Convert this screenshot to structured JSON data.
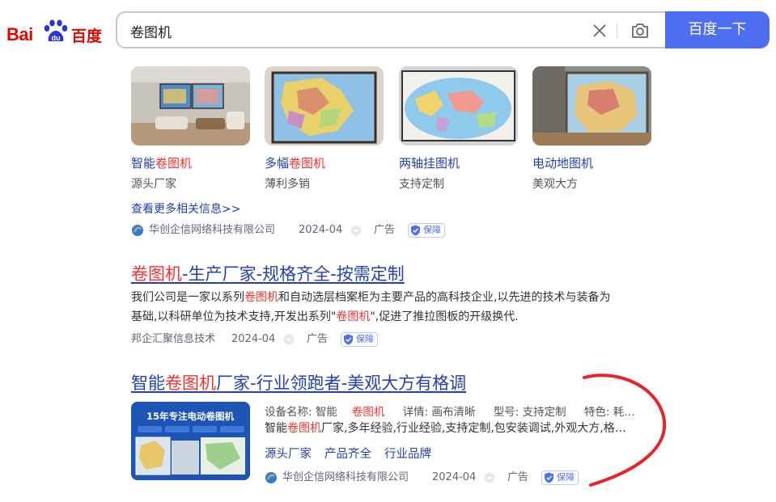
{
  "logo": {
    "bai": "Bai",
    "du": "du",
    "cn": "百度"
  },
  "search": {
    "value": "卷图机",
    "button": "百度一下"
  },
  "image_cards": [
    {
      "title_hl": "智能",
      "title_red": "卷图机",
      "title_tail": "",
      "sub": "源头厂家"
    },
    {
      "title_hl": "多幅",
      "title_red": "卷图机",
      "title_tail": "",
      "sub": "薄利多销"
    },
    {
      "title_hl": "两轴挂图机",
      "title_red": "",
      "title_tail": "",
      "sub": "支持定制"
    },
    {
      "title_hl": "电动地图机",
      "title_red": "",
      "title_tail": "",
      "sub": "美观大方"
    }
  ],
  "more_link": "查看更多相关信息>>",
  "source1": {
    "company": "华创企信网络科技有限公司",
    "date": "2024-04",
    "ad": "广告",
    "badge": "保障"
  },
  "result2": {
    "title_red": "卷图机",
    "title_rest": "-生产厂家-规格齐全-按需定制",
    "line1_a": "我们公司是一家以系列",
    "line1_red": "卷图机",
    "line1_b": "和自动选层档案柜为主要产品的高科技企业,以先进的技术与装备为",
    "line2_a": "基础,以科研单位为技术支持,开发出系列\"",
    "line2_red": "卷图机",
    "line2_b": "\",促进了推拉图板的开级换代.",
    "company": "邦企汇聚信息技术",
    "date": "2024-04",
    "ad": "广告",
    "badge": "保障"
  },
  "result3": {
    "title_a": "智能",
    "title_red": "卷图机",
    "title_b": "厂家-行业领跑者-美观大方有格调",
    "thumb_text": "15年专注电动卷图机",
    "meta": [
      "设备名称: 智能",
      "卷图机",
      "详情: 画布清晰",
      "型号: 支持定制",
      "特色: 耗…"
    ],
    "desc_a": "智能",
    "desc_red": "卷图机",
    "desc_b": "厂家,多年经验,行业经验,支持定制,包安装调试,外观大方,格…",
    "tags": [
      "源头厂家",
      "产品齐全",
      "行业品牌"
    ],
    "company": "华创企信网络科技有限公司",
    "date": "2024-04",
    "ad": "广告",
    "badge": "保障"
  },
  "colors": {
    "link": "#2440b3",
    "highlight": "#f73131",
    "button": "#4e6ef2",
    "annotation": "#e8232a"
  }
}
